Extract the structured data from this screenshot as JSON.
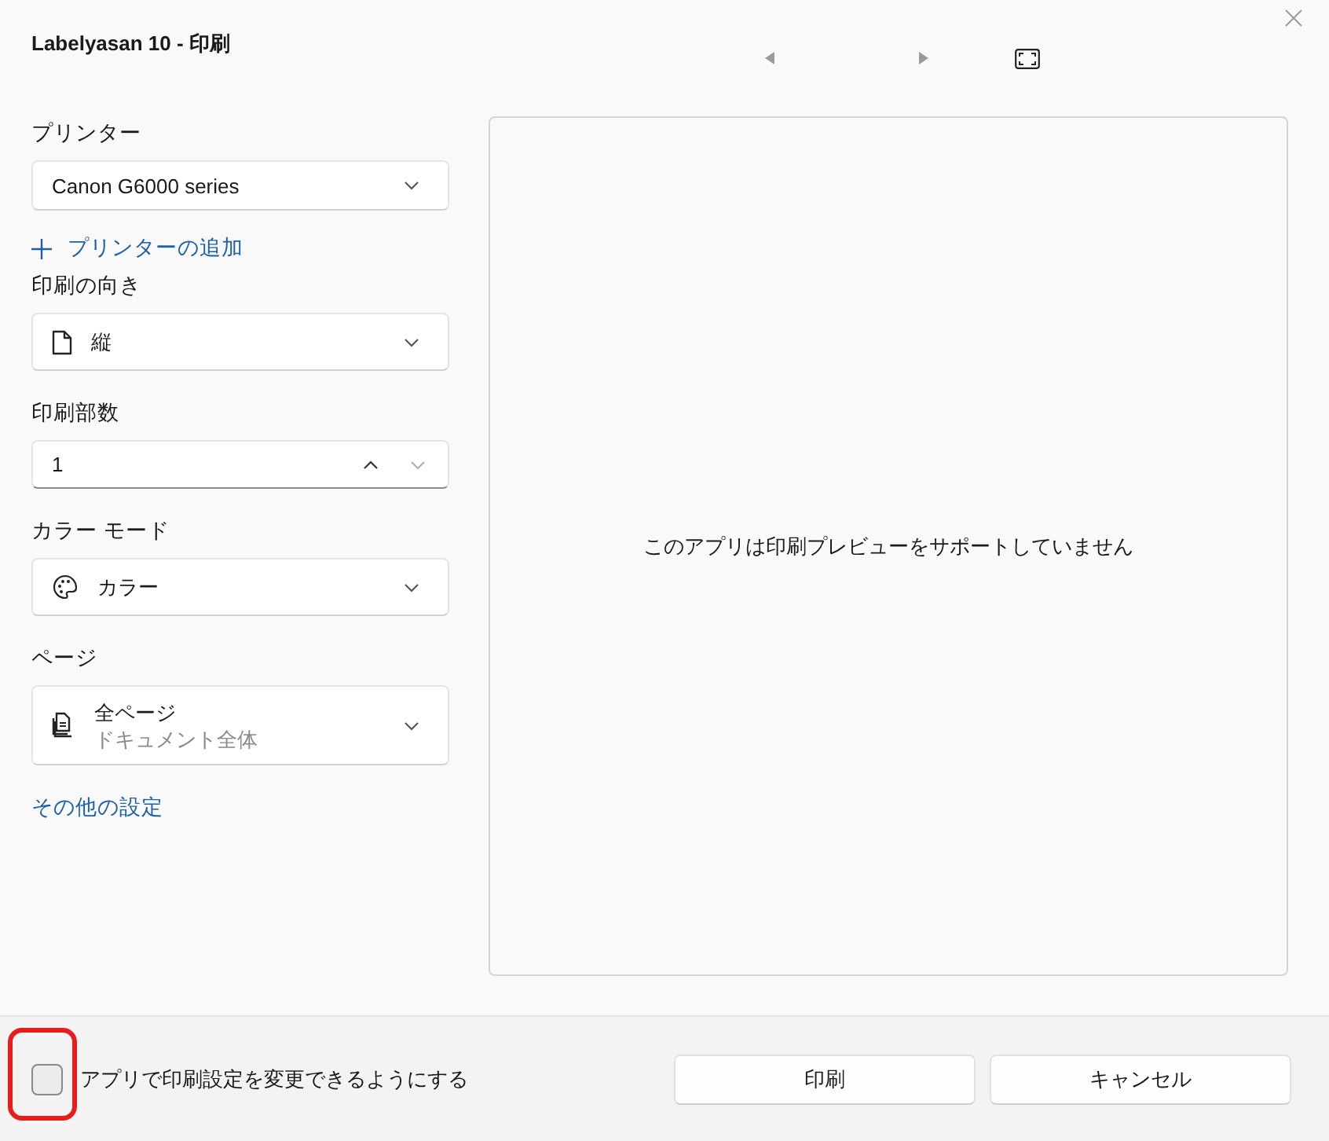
{
  "window": {
    "title": "Labelyasan 10 - 印刷"
  },
  "preview_nav": {
    "previous_disabled": true,
    "next_disabled": true
  },
  "printer": {
    "label": "プリンター",
    "value": "Canon G6000 series"
  },
  "add_printer": {
    "text": "プリンターの追加"
  },
  "orientation": {
    "label": "印刷の向き",
    "value": "縦"
  },
  "copies": {
    "label": "印刷部数",
    "value": "1",
    "increment_disabled": false,
    "decrement_disabled": true
  },
  "color_mode": {
    "label": "カラー モード",
    "value": "カラー"
  },
  "pages": {
    "label": "ページ",
    "value": "全ページ",
    "description": "ドキュメント全体"
  },
  "more_settings": {
    "text": "その他の設定"
  },
  "preview": {
    "message": "このアプリは印刷プレビューをサポートしていません"
  },
  "footer": {
    "checkbox": {
      "label": "アプリで印刷設定を変更できるようにする",
      "checked": false
    },
    "buttons": [
      {
        "label": "印刷"
      },
      {
        "label": "キャンセル"
      }
    ]
  }
}
